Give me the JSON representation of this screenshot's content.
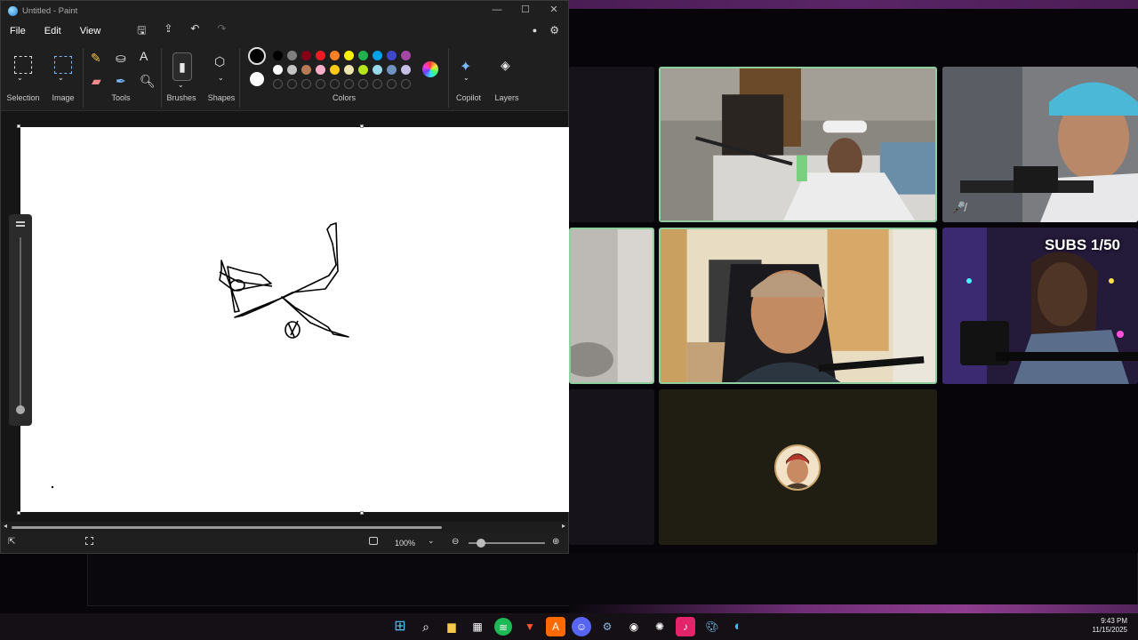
{
  "paint": {
    "title": "Untitled - Paint",
    "window_controls": {
      "minimize": "—",
      "maximize": "☐",
      "close": "✕"
    },
    "menu": {
      "file": "File",
      "edit": "Edit",
      "view": "View"
    },
    "groups": {
      "selection": "Selection",
      "image": "Image",
      "tools": "Tools",
      "brushes": "Brushes",
      "shapes": "Shapes",
      "colors": "Colors",
      "copilot": "Copilot",
      "layers": "Layers"
    },
    "text_tool": "A",
    "colors": {
      "primary": "#000000",
      "secondary": "#ffffff",
      "palette_row1": [
        "#000000",
        "#7f7f7f",
        "#880015",
        "#ed1c24",
        "#ff7f27",
        "#fff200",
        "#22b14c",
        "#00a2e8",
        "#3f48cc",
        "#a349a4"
      ],
      "palette_row2": [
        "#ffffff",
        "#c3c3c3",
        "#b97a57",
        "#ffaec9",
        "#ffc90e",
        "#efe4b0",
        "#b5e61d",
        "#99d9ea",
        "#7092be",
        "#c8bfe7"
      ]
    },
    "status": {
      "zoom": "100%"
    }
  },
  "call": {
    "subs_text": "SUBS 1/50"
  },
  "taskbar": {
    "time": "9:43 PM",
    "date": "11/15/2025"
  }
}
